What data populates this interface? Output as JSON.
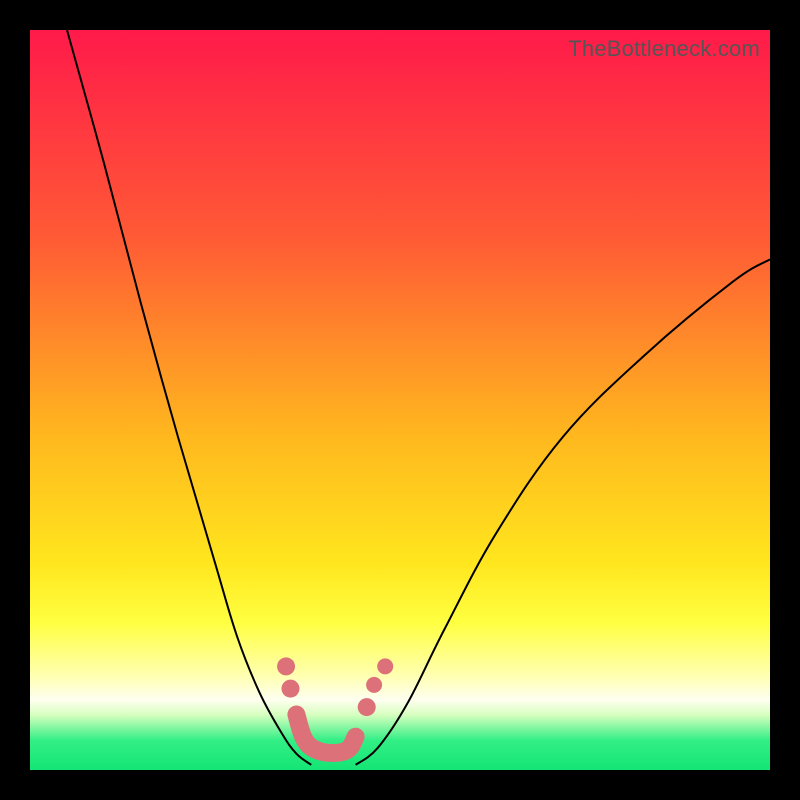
{
  "credit": "TheBottleneck.com",
  "colors": {
    "top": "#ff1a4a",
    "mid1": "#ff6a2e",
    "mid2": "#ffcc1f",
    "mid3": "#ffff33",
    "pale": "#ffffb0",
    "green": "#1ef07c",
    "marker": "#dd7179",
    "curve": "#000000"
  },
  "chart_data": {
    "type": "line",
    "title": "",
    "xlabel": "",
    "ylabel": "",
    "xlim": [
      0,
      100
    ],
    "ylim": [
      0,
      100
    ],
    "series": [
      {
        "name": "left-curve",
        "x": [
          5,
          10,
          15,
          20,
          25,
          28,
          31,
          34,
          36,
          38
        ],
        "y": [
          100,
          82,
          63,
          45,
          28,
          18,
          10.5,
          5,
          2.2,
          0.7
        ]
      },
      {
        "name": "right-curve",
        "x": [
          44,
          47,
          51,
          56,
          63,
          72,
          83,
          95,
          100
        ],
        "y": [
          0.7,
          3,
          9,
          19,
          32,
          45,
          56,
          66,
          69
        ]
      }
    ],
    "gradient_stops": [
      {
        "pos": 0.0,
        "color": "#ff1a4a"
      },
      {
        "pos": 0.28,
        "color": "#ff5a35"
      },
      {
        "pos": 0.55,
        "color": "#ffb81e"
      },
      {
        "pos": 0.72,
        "color": "#ffe61e"
      },
      {
        "pos": 0.8,
        "color": "#ffff40"
      },
      {
        "pos": 0.875,
        "color": "#ffffb5"
      },
      {
        "pos": 0.905,
        "color": "#fefff0"
      },
      {
        "pos": 0.925,
        "color": "#d8ffc0"
      },
      {
        "pos": 0.96,
        "color": "#32ef85"
      },
      {
        "pos": 1.0,
        "color": "#14e575"
      }
    ],
    "markers": [
      {
        "x": 34.6,
        "y": 14.0,
        "r": 9
      },
      {
        "x": 35.2,
        "y": 11.0,
        "r": 9
      },
      {
        "x": 45.5,
        "y": 8.5,
        "r": 9
      },
      {
        "x": 46.5,
        "y": 11.5,
        "r": 8
      },
      {
        "x": 48.0,
        "y": 14.0,
        "r": 8
      }
    ],
    "trough_path": [
      {
        "x": 36.0,
        "y": 7.5
      },
      {
        "x": 37.0,
        "y": 4.3
      },
      {
        "x": 38.5,
        "y": 2.8
      },
      {
        "x": 41.0,
        "y": 2.3
      },
      {
        "x": 43.0,
        "y": 2.8
      },
      {
        "x": 44.0,
        "y": 4.5
      }
    ]
  }
}
